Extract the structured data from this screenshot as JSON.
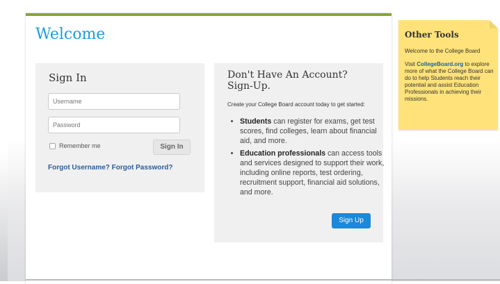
{
  "welcome": {
    "title": "Welcome"
  },
  "signin": {
    "title": "Sign In",
    "username_placeholder": "Username",
    "password_placeholder": "Password",
    "remember_label": "Remember me",
    "signin_button": "Sign In",
    "forgot_link": "Forgot Username? Forgot Password?"
  },
  "signup": {
    "title": "Don't Have An Account? Sign-Up.",
    "intro": "Create your College Board account today to get started:",
    "items": [
      {
        "bold": "Students",
        "text": " can register for exams, get test scores, find colleges, learn about financial aid, and more."
      },
      {
        "bold": "Education professionals",
        "text": " can access tools and services designed to support their work, including online reports, test ordering, recruitment support, financial aid solutions, and more."
      }
    ],
    "button": "Sign Up"
  },
  "other_tools": {
    "title": "Other Tools",
    "p1": "Welcome to the College Board",
    "p2_before": "Visit ",
    "p2_link": "CollegeBoard.org",
    "p2_after": " to explore more of what the College Board can do to help Students reach their potential and assist Education Professionals in achieving their missions."
  },
  "colors": {
    "accent_green": "#86a43a",
    "title_blue": "#1b9de2",
    "button_blue": "#1b88d8",
    "note_yellow": "#ffe27a"
  }
}
